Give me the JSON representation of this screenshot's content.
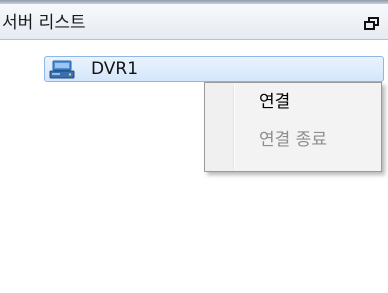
{
  "panel": {
    "title": "서버 리스트",
    "pin_icon": "pin-icon"
  },
  "tree": {
    "items": [
      {
        "label": "DVR1",
        "icon": "server-icon",
        "selected": true
      }
    ]
  },
  "context_menu": {
    "items": [
      {
        "label": "연결",
        "enabled": true
      },
      {
        "label": "연결 종료",
        "enabled": false
      }
    ]
  },
  "colors": {
    "selection_fill": "#d4e6fb",
    "selection_border": "#8fb6e6",
    "disabled_text": "#8d8d8d"
  }
}
